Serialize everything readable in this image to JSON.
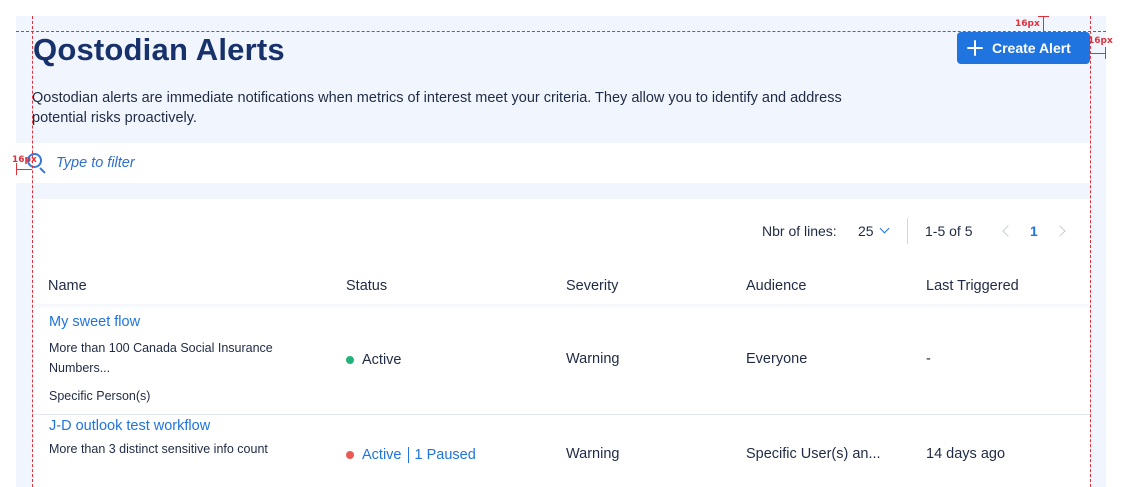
{
  "header": {
    "title": "Qostodian Alerts",
    "description": "Qostodian alerts are immediate notifications when metrics of interest meet your criteria. They allow you to identify and address potential risks proactively.",
    "create_button_label": "Create Alert"
  },
  "filter": {
    "placeholder": "Type to filter",
    "value": ""
  },
  "annotations": {
    "top_spacing": "16px",
    "right_spacing": "16px",
    "left_spacing": "16px"
  },
  "pagination": {
    "lines_label": "Nbr of lines:",
    "lines_value": "25",
    "range": "1-5 of 5",
    "current_page": "1"
  },
  "table": {
    "columns": [
      "Name",
      "Status",
      "Severity",
      "Audience",
      "Last Triggered"
    ],
    "rows": [
      {
        "name": "My sweet flow",
        "description": "More than 100 Canada Social Insurance Numbers...",
        "target": "Specific Person(s)",
        "status": "Active",
        "status_extra": "",
        "severity": "Warning",
        "audience": "Everyone",
        "last_triggered": "-"
      },
      {
        "name": "J-D outlook test workflow",
        "description": "More than 3 distinct sensitive info count",
        "target": "",
        "status": "Active",
        "status_extra": "1 Paused",
        "severity": "Warning",
        "audience": "Specific User(s) an...",
        "last_triggered": "14 days ago"
      }
    ]
  },
  "colors": {
    "accent": "#1f74e0",
    "title": "#17316b",
    "panel_bg": "#f1f5fd",
    "status_active": "#22b37a",
    "status_mixed": "#ea5a55",
    "guide": "#e0303a"
  },
  "icons": [
    "plus-icon",
    "search-icon",
    "chevron-down-icon",
    "chevron-left-icon",
    "chevron-right-icon"
  ]
}
